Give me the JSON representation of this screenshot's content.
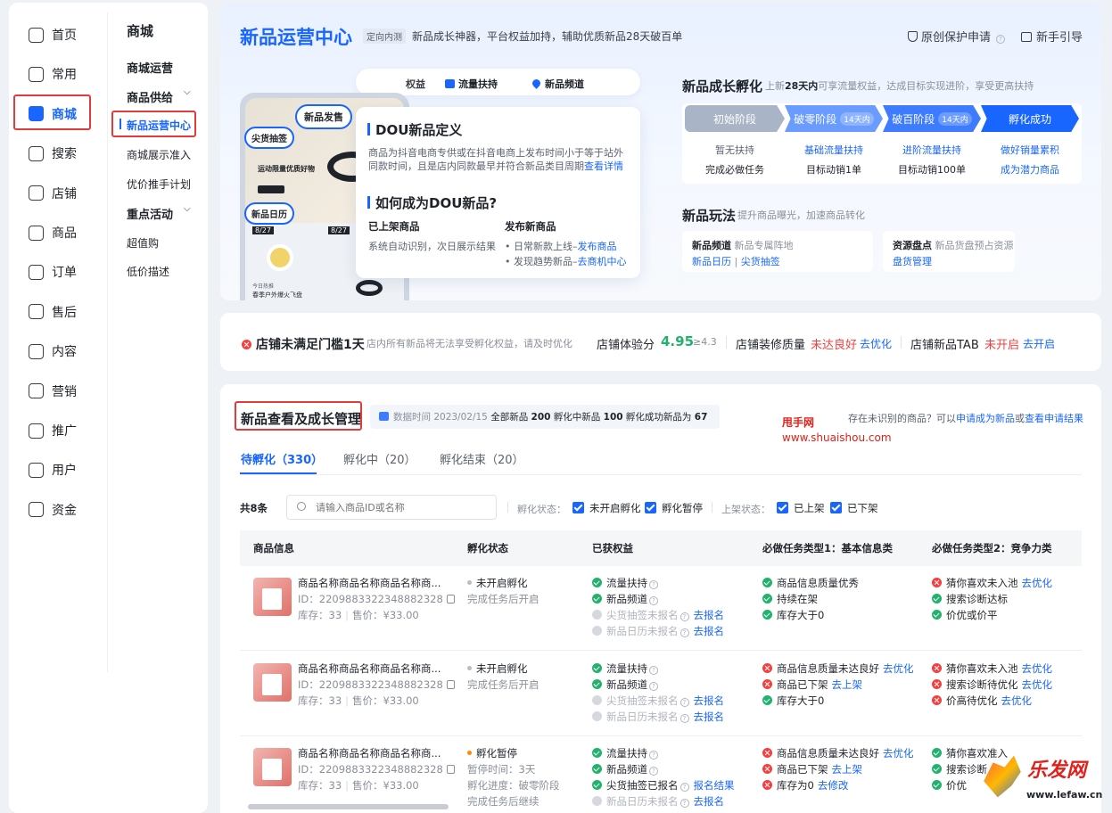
{
  "nav": {
    "items": [
      {
        "label": "首页",
        "icon": "home-outline-icon"
      },
      {
        "label": "常用",
        "icon": "folder-icon"
      },
      {
        "label": "商城",
        "icon": "store-icon"
      },
      {
        "label": "搜索",
        "icon": "search-icon"
      },
      {
        "label": "店铺",
        "icon": "shop-icon"
      },
      {
        "label": "商品",
        "icon": "bag-icon"
      },
      {
        "label": "订单",
        "icon": "order-icon"
      },
      {
        "label": "售后",
        "icon": "aftersale-icon"
      },
      {
        "label": "内容",
        "icon": "tv-icon"
      },
      {
        "label": "营销",
        "icon": "megaphone-icon"
      },
      {
        "label": "推广",
        "icon": "promo-icon"
      },
      {
        "label": "用户",
        "icon": "user-icon"
      },
      {
        "label": "资金",
        "icon": "wallet-icon"
      }
    ]
  },
  "subnav": {
    "title": "商城",
    "mall_ops": "商城运营",
    "supply": "商品供给",
    "new_center": "新品运营中心",
    "mall_display": "商城展示准入",
    "price_push": "优价推手计划",
    "key_events": "重点活动",
    "super_value": "超值购",
    "low_price": "低价描述"
  },
  "hero": {
    "title": "新品运营中心",
    "tag": "定向内测",
    "subtitle": "新品成长神器，平台权益加持，辅助优质新品28天破百单",
    "protect": "原创保护申请",
    "guide": "新手引导",
    "tabs": {
      "rights": "权益",
      "traffic": "流量扶持",
      "channel": "新品频道"
    },
    "bubbles": {
      "launch": "新品发售",
      "snap": "尖货抽签",
      "calendar": "新品日历"
    },
    "phone": {
      "promo": "运动限量优质好物",
      "date1": "8/27",
      "date2": "8/27",
      "item": "今日热推",
      "item2": "春季户外爆火飞盘"
    },
    "def_title": "DOU新品定义",
    "def_text1": "商品为抖音电商专供或在抖音电商上发布时间小于等于站外",
    "def_text2": "同款时间，且是店内同款最早并符合新品类目周期",
    "def_link": "查看详情",
    "how_title": "如何成为DOU新品?",
    "listed_title": "已上架商品",
    "listed_text": "系统自动识别，次日展示结果",
    "publish_title": "发布新商品",
    "publish_1": "日常新款上线–",
    "publish_1_link": "发布商品",
    "publish_2": "发现趋势新品–",
    "publish_2_link": "去商机中心"
  },
  "growth": {
    "title": "新品成长孵化",
    "desc_a": "上新",
    "desc_b": "28天内",
    "desc_c": "可享流量权益，达成目标实现进阶，享受更高扶持",
    "stages": [
      {
        "name": "初始阶段",
        "pill": "",
        "l1": "暂无扶持",
        "l2": "完成必做任务",
        "color": "#a9b4c6"
      },
      {
        "name": "破零阶段",
        "pill": "14天内",
        "l1": "基础流量扶持",
        "l2": "目标动销1单",
        "color": "#6a9bff"
      },
      {
        "name": "破百阶段",
        "pill": "14天内",
        "l1": "进阶流量扶持",
        "l2": "目标动销100单",
        "color": "#3d7bff"
      },
      {
        "name": "孵化成功",
        "pill": "",
        "l1": "做好销量累积",
        "l2": "成为潜力商品",
        "color": "#1966ff"
      }
    ],
    "play_title": "新品玩法",
    "play_desc": "提升商品曝光，加速商品转化",
    "channel_title": "新品频道",
    "channel_desc": "新品专属阵地",
    "channel_link1": "新品日历",
    "channel_link2": "尖货抽签",
    "inventory_title": "资源盘点",
    "inventory_desc": "新品货盘预占资源",
    "inventory_link": "盘货管理"
  },
  "status": {
    "warn_title": "店铺未满足门槛1天",
    "warn_desc": "店内所有新品将无法享受孵化权益，请及时优化",
    "score_label": "店铺体验分",
    "score": "4.95",
    "score_req": "≥4.3",
    "decor_label": "店铺装修质量",
    "decor_val": "未达良好",
    "decor_link": "去优化",
    "tab_label": "店铺新品TAB",
    "tab_val": "未开启",
    "tab_link": "去开启"
  },
  "manage": {
    "title": "新品查看及成长管理",
    "stats_date": "数据时间 2023/02/15",
    "stats_all_label": "全部新品",
    "stats_all": "200",
    "stats_inc_label": "孵化中新品",
    "stats_inc": "100",
    "stats_succ_label": "孵化成功新品为",
    "stats_succ": "67",
    "unrecognized": "存在未识别的商品？可以",
    "apply_link": "申请成为新品",
    "or": "或",
    "result_link": "查看申请结果",
    "watermark1": "甩手网",
    "watermark2": "www.shuaishou.com",
    "tabs": [
      "待孵化（330）",
      "孵化中（20）",
      "孵化结束（20）"
    ],
    "count": "共8条",
    "search_ph": "请输入商品ID或名称",
    "inc_status_label": "孵化状态：",
    "filter_a": "未开启孵化",
    "filter_b": "孵化暂停",
    "shelf_label": "上架状态：",
    "filter_c": "已上架",
    "filter_d": "已下架",
    "columns": [
      "商品信息",
      "孵化状态",
      "已获权益",
      "必做任务类型1：基本信息类",
      "必做任务类型2：竞争力类"
    ]
  },
  "rows": [
    {
      "name": "商品名称商品名称商品名称商...",
      "id": "ID：2209883322348882328",
      "stock": "库存：33",
      "price": "售价：¥33.00",
      "status": "未开启孵化",
      "status_dot": "#b8bcc4",
      "status_sub": "完成任务后开启",
      "rights": [
        {
          "t": "流量扶持",
          "s": "ok",
          "q": true
        },
        {
          "t": "新品频道",
          "s": "ok",
          "q": true
        },
        {
          "t": "尖货抽签未报名",
          "s": "dim",
          "q": true,
          "link": "去报名"
        },
        {
          "t": "新品日历未报名",
          "s": "dim",
          "q": true,
          "link": "去报名"
        }
      ],
      "task1": [
        {
          "t": "商品信息质量优秀",
          "s": "ok"
        },
        {
          "t": "持续在架",
          "s": "ok"
        },
        {
          "t": "库存大于0",
          "s": "ok"
        }
      ],
      "task2": [
        {
          "t": "猜你喜欢未入池",
          "s": "no",
          "link": "去优化"
        },
        {
          "t": "搜索诊断达标",
          "s": "ok"
        },
        {
          "t": "价优或价平",
          "s": "ok"
        }
      ]
    },
    {
      "name": "商品名称商品名称商品名称商...",
      "id": "ID：2209883322348882328",
      "stock": "库存：33",
      "price": "售价：¥33.00",
      "status": "未开启孵化",
      "status_dot": "#b8bcc4",
      "status_sub": "完成任务后开启",
      "rights": [
        {
          "t": "流量扶持",
          "s": "ok",
          "q": true
        },
        {
          "t": "新品频道",
          "s": "ok",
          "q": true
        },
        {
          "t": "尖货抽签未报名",
          "s": "dim",
          "q": true,
          "link": "去报名"
        },
        {
          "t": "新品日历未报名",
          "s": "dim",
          "q": true,
          "link": "去报名"
        }
      ],
      "task1": [
        {
          "t": "商品信息质量未达良好",
          "s": "no",
          "link": "去优化"
        },
        {
          "t": "商品已下架",
          "s": "no",
          "link": "去上架"
        },
        {
          "t": "库存大于0",
          "s": "ok"
        }
      ],
      "task2": [
        {
          "t": "猜你喜欢未入池",
          "s": "no",
          "link": "去优化"
        },
        {
          "t": "搜索诊断待优化",
          "s": "no",
          "link": "去优化"
        },
        {
          "t": "价高待优化",
          "s": "no",
          "link": "去优化"
        }
      ]
    },
    {
      "name": "商品名称商品名称商品名称商...",
      "id": "ID：2209883322348882328",
      "stock": "库存：33",
      "price": "售价：¥33.00",
      "status": "孵化暂停",
      "status_dot": "#ff8a00",
      "status_sub": "暂停时间：3天",
      "status_sub2": "孵化进度：破零阶段",
      "status_sub3": "完成任务后继续",
      "rights": [
        {
          "t": "流量扶持",
          "s": "ok",
          "q": true
        },
        {
          "t": "新品频道",
          "s": "ok",
          "q": true
        },
        {
          "t": "尖货抽签已报名",
          "s": "ok",
          "q": true,
          "link": "报名结果"
        },
        {
          "t": "新品日历未报名",
          "s": "dim",
          "q": true,
          "link": "去报名"
        }
      ],
      "task1": [
        {
          "t": "商品信息质量未达良好",
          "s": "no",
          "link": "去优化"
        },
        {
          "t": "商品已下架",
          "s": "no",
          "link": "去上架"
        },
        {
          "t": "库存为0",
          "s": "no",
          "link": "去修改"
        }
      ],
      "task2": [
        {
          "t": "猜你喜欢准入",
          "s": "ok"
        },
        {
          "t": "搜索诊断",
          "s": "ok"
        },
        {
          "t": "价优",
          "s": "ok"
        }
      ]
    }
  ],
  "corner_logo": {
    "brand": "乐发网",
    "url": "www.lefaw.cn"
  }
}
